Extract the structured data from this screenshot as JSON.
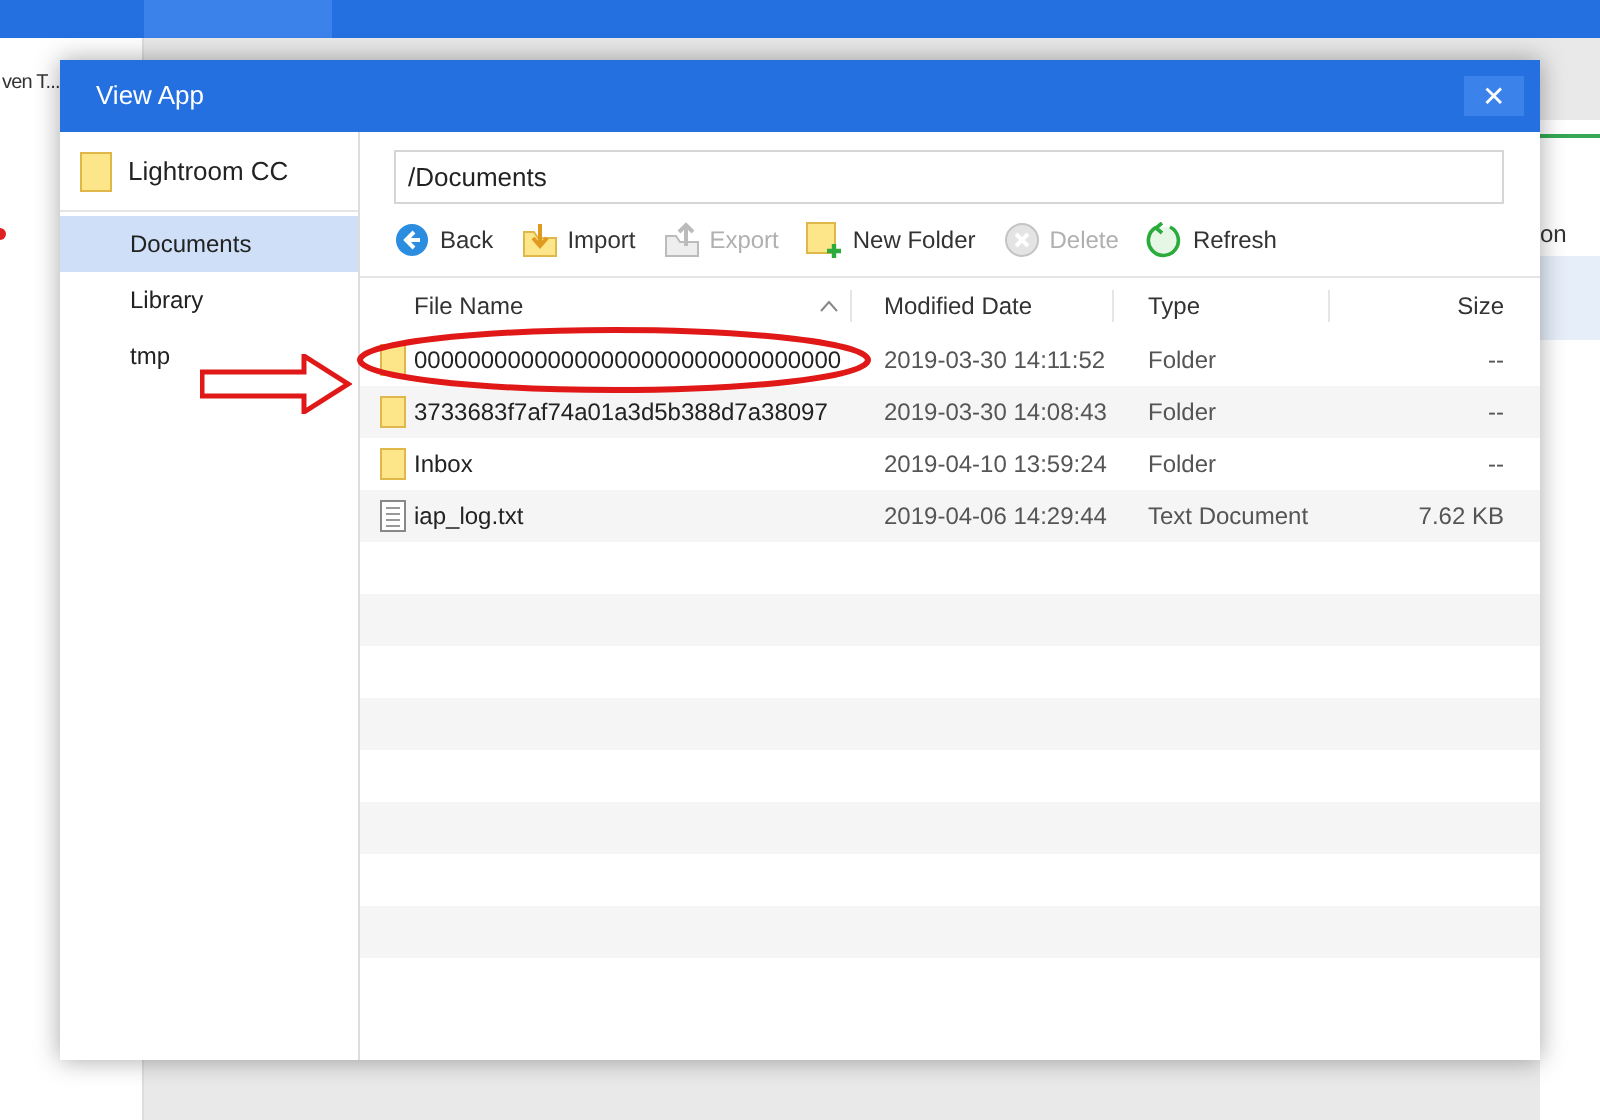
{
  "background_app": {
    "list_text": "ven T...",
    "column_text": "on"
  },
  "window": {
    "title": "View App",
    "close": "✕"
  },
  "sidebar": {
    "app_name": "Lightroom CC",
    "items": [
      {
        "label": "Documents",
        "selected": true
      },
      {
        "label": "Library",
        "selected": false
      },
      {
        "label": "tmp",
        "selected": false
      }
    ]
  },
  "path": "/Documents",
  "toolbar": [
    {
      "kind": "back",
      "label": "Back",
      "disabled": false
    },
    {
      "kind": "import",
      "label": "Import",
      "disabled": false
    },
    {
      "kind": "export",
      "label": "Export",
      "disabled": true
    },
    {
      "kind": "new-folder",
      "label": "New Folder",
      "disabled": false
    },
    {
      "kind": "delete",
      "label": "Delete",
      "disabled": true
    },
    {
      "kind": "refresh",
      "label": "Refresh",
      "disabled": false
    }
  ],
  "table": {
    "columns": [
      "File Name",
      "Modified Date",
      "Type",
      "Size"
    ],
    "rows": [
      {
        "kind": "folder",
        "name": "00000000000000000000000000000000",
        "modified": "2019-03-30 14:11:52",
        "type": "Folder",
        "size": "--",
        "highlighted": true
      },
      {
        "kind": "folder",
        "name": "3733683f7af74a01a3d5b388d7a38097",
        "modified": "2019-03-30 14:08:43",
        "type": "Folder",
        "size": "--",
        "highlighted": false
      },
      {
        "kind": "folder",
        "name": "Inbox",
        "modified": "2019-04-10 13:59:24",
        "type": "Folder",
        "size": "--",
        "highlighted": false
      },
      {
        "kind": "file",
        "name": "iap_log.txt",
        "modified": "2019-04-06 14:29:44",
        "type": "Text Document",
        "size": "7.62 KB",
        "highlighted": false
      }
    ]
  }
}
